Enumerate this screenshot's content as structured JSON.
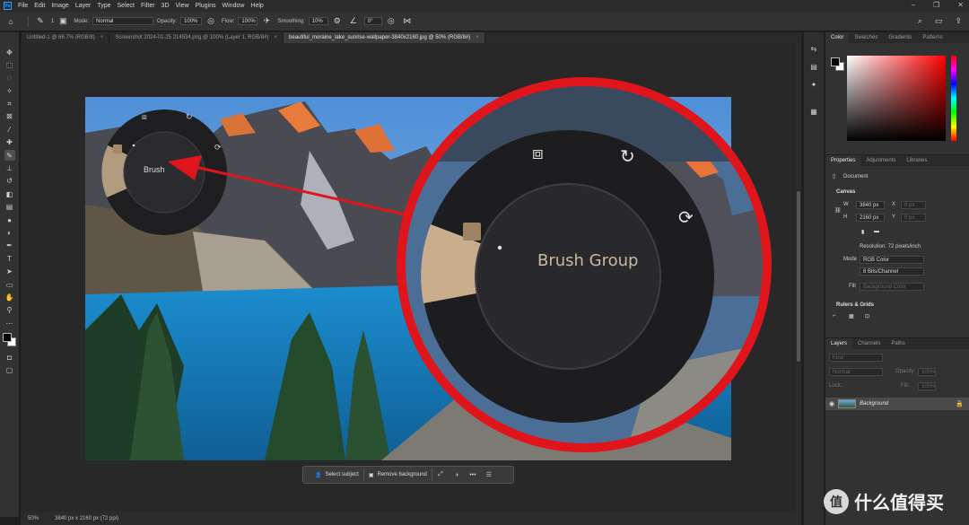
{
  "menubar": {
    "logo": "Ps",
    "items": [
      "File",
      "Edit",
      "Image",
      "Layer",
      "Type",
      "Select",
      "Filter",
      "3D",
      "View",
      "Plugins",
      "Window",
      "Help"
    ]
  },
  "options": {
    "brush_size": "1",
    "mode_label": "Mode:",
    "mode_value": "Normal",
    "opacity_label": "Opacity:",
    "opacity_value": "100%",
    "flow_label": "Flow:",
    "flow_value": "100%",
    "smoothing_label": "Smoothing:",
    "smoothing_value": "10%",
    "angle_value": "0°"
  },
  "tabs": [
    {
      "label": "Untitled-1 @ 66.7% (RGB/8)",
      "close": "×"
    },
    {
      "label": "Screenshot 2024-01-25 214534.png @ 100% (Layer 1, RGB/8#)",
      "close": "×"
    },
    {
      "label": "beautiful_moraine_lake_sunrise-wallpaper-3840x2160.jpg @ 50% (RGB/8#)",
      "close": "×"
    }
  ],
  "radial": {
    "small_label": "Brush",
    "large_label": "Brush Group"
  },
  "taskbar": {
    "select_subject": "Select subject",
    "remove_background": "Remove background",
    "more": "•••"
  },
  "status": {
    "zoom": "50%",
    "dimensions": "3840 px x 2160 px (72 ppi)"
  },
  "color_panel": {
    "tabs": [
      "Color",
      "Swatches",
      "Gradients",
      "Patterns"
    ]
  },
  "properties": {
    "tabs": [
      "Properties",
      "Adjustments",
      "Libraries"
    ],
    "document": "Document",
    "canvas_title": "Canvas",
    "w_label": "W",
    "w_value": "3840 px",
    "h_label": "H",
    "h_value": "2160 px",
    "x_label": "X",
    "x_value": "0 px",
    "y_label": "Y",
    "y_value": "0 px",
    "resolution": "Resolution: 72 pixels/inch",
    "mode_label": "Mode",
    "mode_value": "RGB Color",
    "depth_value": "8 Bits/Channel",
    "fill_label": "Fill",
    "fill_value": "Background Color",
    "rulers_title": "Rulers & Grids"
  },
  "layers_panel": {
    "tabs": [
      "Layers",
      "Channels",
      "Paths"
    ],
    "kind_placeholder": "Kind",
    "blend_mode": "Normal",
    "opacity_label": "Opacity:",
    "opacity_value": "100%",
    "lock_label": "Lock:",
    "fill_label": "Fill:",
    "fill_value": "100%",
    "layer_name": "Background"
  },
  "watermark": {
    "badge": "值",
    "text": "什么值得买"
  }
}
